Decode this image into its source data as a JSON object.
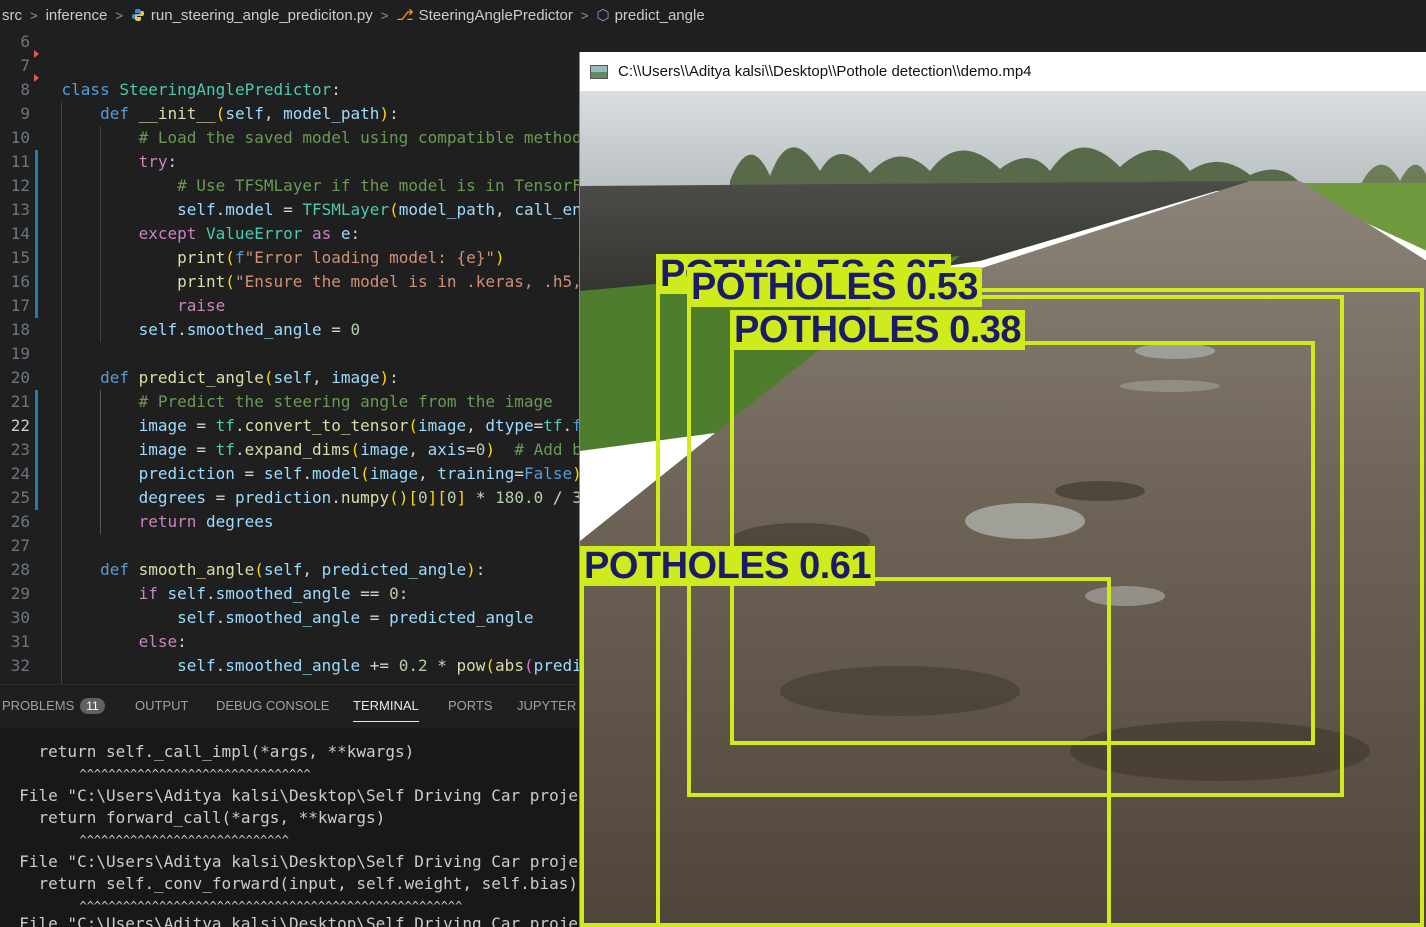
{
  "breadcrumb": {
    "items": [
      "src",
      "inference",
      "run_steering_angle_prediciton.py",
      "SteeringAnglePredictor",
      "predict_angle"
    ]
  },
  "editor": {
    "active_line": 22,
    "lines": [
      {
        "n": "6",
        "code": ""
      },
      {
        "n": "7",
        "code": ""
      },
      {
        "n": "8",
        "code": "class SteeringAnglePredictor:"
      },
      {
        "n": "9",
        "code": "    def __init__(self, model_path):"
      },
      {
        "n": "10",
        "code": "        # Load the saved model using compatible method"
      },
      {
        "n": "11",
        "code": "        try:"
      },
      {
        "n": "12",
        "code": "            # Use TFSMLayer if the model is in TensorF"
      },
      {
        "n": "13",
        "code": "            self.model = TFSMLayer(model_path, call_en"
      },
      {
        "n": "14",
        "code": "        except ValueError as e:"
      },
      {
        "n": "15",
        "code": "            print(f\"Error loading model: {e}\")"
      },
      {
        "n": "16",
        "code": "            print(\"Ensure the model is in .keras, .h5,"
      },
      {
        "n": "17",
        "code": "            raise"
      },
      {
        "n": "18",
        "code": "        self.smoothed_angle = 0"
      },
      {
        "n": "19",
        "code": ""
      },
      {
        "n": "20",
        "code": "    def predict_angle(self, image):"
      },
      {
        "n": "21",
        "code": "        # Predict the steering angle from the image"
      },
      {
        "n": "22",
        "code": "        image = tf.convert_to_tensor(image, dtype=tf.f"
      },
      {
        "n": "23",
        "code": "        image = tf.expand_dims(image, axis=0)  # Add b"
      },
      {
        "n": "24",
        "code": "        prediction = self.model(image, training=False)"
      },
      {
        "n": "25",
        "code": "        degrees = prediction.numpy()[0][0] * 180.0 / 3"
      },
      {
        "n": "26",
        "code": "        return degrees"
      },
      {
        "n": "27",
        "code": ""
      },
      {
        "n": "28",
        "code": "    def smooth_angle(self, predicted_angle):"
      },
      {
        "n": "29",
        "code": "        if self.smoothed_angle == 0:"
      },
      {
        "n": "30",
        "code": "            self.smoothed_angle = predicted_angle"
      },
      {
        "n": "31",
        "code": "        else:"
      },
      {
        "n": "32",
        "code": "            self.smoothed_angle += 0.2 * pow(abs(predi"
      }
    ]
  },
  "panel": {
    "tabs": [
      "PROBLEMS",
      "OUTPUT",
      "DEBUG CONSOLE",
      "TERMINAL",
      "PORTS",
      "JUPYTER"
    ],
    "problems_count": "11",
    "active_tab": "TERMINAL"
  },
  "terminal": {
    "lines": [
      "    return self._call_impl(*args, **kwargs)",
      "           ^^^^^^^^^^^^^^^^^^^^^^^^^^^^^^^^",
      "  File \"C:\\Users\\Aditya kalsi\\Desktop\\Self Driving Car project\\d",
      "    return forward_call(*args, **kwargs)",
      "           ^^^^^^^^^^^^^^^^^^^^^^^^^^^^^",
      "  File \"C:\\Users\\Aditya kalsi\\Desktop\\Self Driving Car project\\d",
      "    return self._conv_forward(input, self.weight, self.bias)",
      "           ^^^^^^^^^^^^^^^^^^^^^^^^^^^^^^^^^^^^^^^^^^^^^^^^^^^^^",
      "  File \"C:\\Users\\Aditya kalsi\\Desktop\\Self Driving Car project\\d"
    ]
  },
  "video": {
    "title": "C:\\\\Users\\\\Aditya kalsi\\\\Desktop\\\\Pothole detection\\\\demo.mp4",
    "detections": [
      {
        "label": "POTHOLES 0.25"
      },
      {
        "label": "POTHOLES 0.53"
      },
      {
        "label": "POTHOLES 0.38"
      },
      {
        "label": "POTHOLES 0.61"
      }
    ],
    "box_color": "#cfeb1c",
    "label_text_color": "#1c1c66"
  }
}
